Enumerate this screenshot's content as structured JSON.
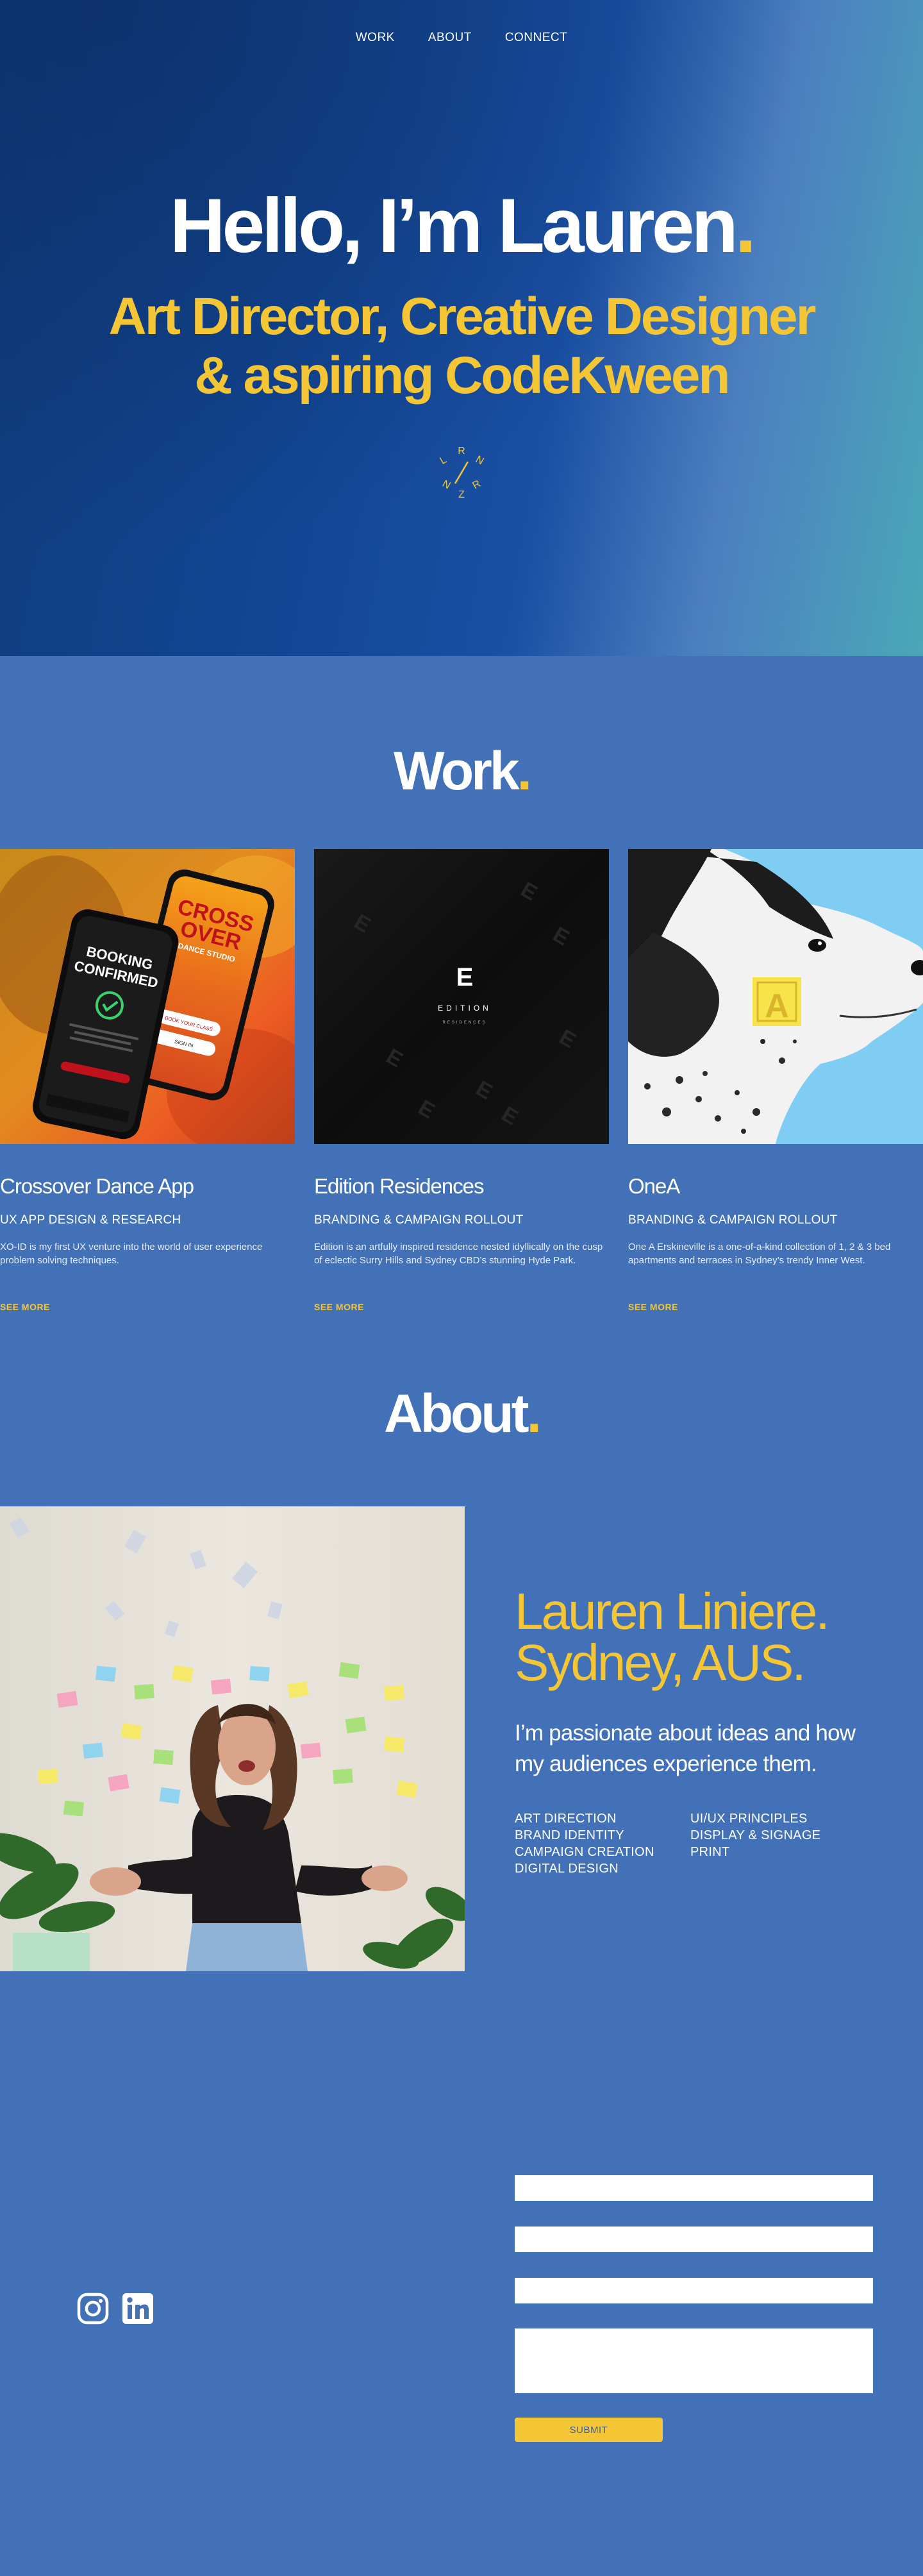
{
  "nav": {
    "items": [
      "WORK",
      "ABOUT",
      "CONNECT"
    ]
  },
  "hero": {
    "title": "Hello, I’m Lauren",
    "title_dot": ".",
    "subtitle_line1": "Art Director, Creative Designer",
    "subtitle_line2": "& aspiring CodeKween",
    "monogram_letters": [
      "L",
      "R",
      "N",
      "N",
      "Z",
      "R"
    ]
  },
  "work": {
    "title": "Work",
    "title_dot": ".",
    "projects": [
      {
        "name": "Crossover Dance App",
        "category": "UX APP DESIGN & RESEARCH",
        "description": "XO-ID is my first UX venture into the world of user experience problem solving techniques.",
        "more": "SEE MORE",
        "image": {
          "phone1_line1": "BOOKING",
          "phone1_line2": "CONFIRMED",
          "phone2_line1": "CROSS",
          "phone2_line2": "OVER",
          "phone2_line3": "DANCE STUDIO",
          "phone2_button1": "BOOK YOUR CLASS",
          "phone2_button2": "SIGN IN"
        }
      },
      {
        "name": "Edition Residences",
        "category": "BRANDING & CAMPAIGN ROLLOUT",
        "description": "Edition is an artfully inspired residence nested idyllically on the cusp of eclectic Surry Hills and Sydney CBD’s stunning Hyde Park.",
        "more": "SEE MORE",
        "image": {
          "letter": "E",
          "wordmark": "EDITION",
          "subword": "RESIDENCES"
        }
      },
      {
        "name": "OneA",
        "category": "BRANDING & CAMPAIGN ROLLOUT",
        "description": "One A Erskineville is a one-of-a-kind collection of 1, 2  & 3 bed apartments and terraces in Sydney’s trendy Inner West.",
        "more": "SEE MORE",
        "image": {
          "badge": "A"
        }
      }
    ]
  },
  "about": {
    "title": "About",
    "title_dot": ".",
    "name_line1": "Lauren Liniere.",
    "name_line2": "Sydney, AUS.",
    "lead": "I’m passionate about ideas and how my audiences experience them.",
    "skills_col1": [
      "ART DIRECTION",
      "BRAND IDENTITY",
      "CAMPAIGN CREATION",
      "DIGITAL DESIGN"
    ],
    "skills_col2": [
      "UI/UX PRINCIPLES",
      "DISPLAY & SIGNAGE",
      "PRINT"
    ]
  },
  "contact": {
    "socials": [
      "instagram-icon",
      "linkedin-icon"
    ],
    "submit": "SUBMIT"
  },
  "colors": {
    "accent": "#f4c534",
    "page_blue": "#4371b8",
    "hero_dark": "#0f3c7d",
    "hero_teal": "#4aa8b8"
  }
}
